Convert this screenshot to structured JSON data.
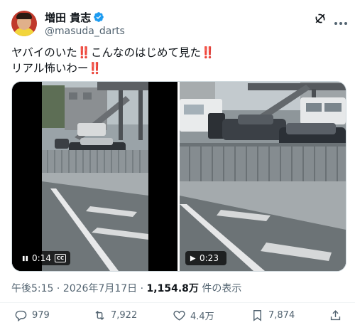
{
  "author": {
    "display_name": "増田 貴志",
    "handle": "@masuda_darts",
    "verified": true,
    "avatar_icon": "profile-photo"
  },
  "tweet": {
    "lines": [
      [
        "ヤバイのいた",
        "‼️",
        "こんなのはじめて見た",
        "‼️"
      ],
      [
        "リアル怖いわー",
        "‼️"
      ]
    ],
    "line1": {
      "a": "ヤバイのいた",
      "b": "‼️",
      "c": "こんなのはじめて見た",
      "d": "‼️"
    },
    "line2": {
      "a": "リアル怖いわー",
      "b": "‼️"
    }
  },
  "media": {
    "video1": {
      "duration": "0:14",
      "state": "paused",
      "icon": "pause-icon",
      "has_cc": true
    },
    "video2": {
      "duration": "0:23",
      "state": "playable",
      "icon": "play-icon"
    }
  },
  "meta": {
    "time": "午後5:15",
    "separator": " · ",
    "date": "2026年7月17日",
    "views_count": "1,154.8万",
    "views_label": " 件の表示"
  },
  "actions": {
    "replies": "979",
    "reposts": "7,922",
    "likes": "4.4万",
    "bookmarks": "7,874"
  },
  "colors": {
    "accent": "#1d9bf0",
    "text": "#0f1419",
    "muted": "#536471",
    "emoji_red": "#e0245e"
  }
}
